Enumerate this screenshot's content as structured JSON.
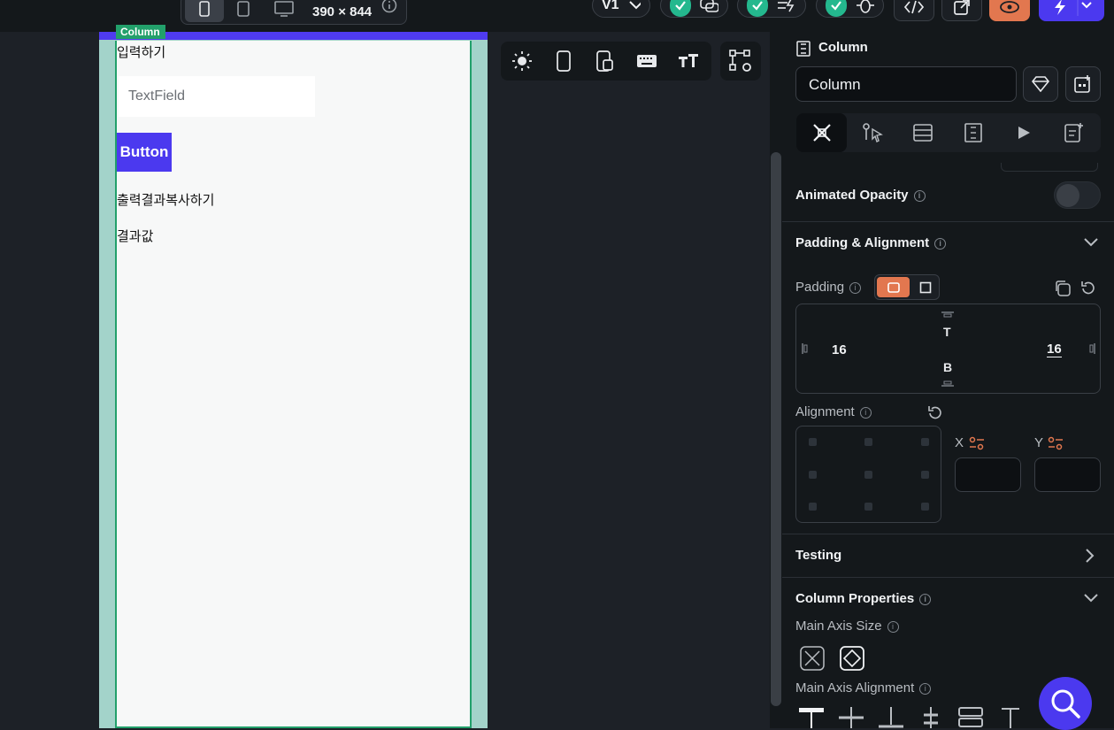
{
  "topbar": {
    "dimensions": "390 × 844",
    "version_label": "V1",
    "colors": {
      "accent": "#4b39ef",
      "success": "#24b88e",
      "preview_active": "#e2774f"
    }
  },
  "canvas": {
    "column_tag": "Column",
    "input_label": "입력하기",
    "textfield_placeholder": "TextField",
    "button_label": "Button",
    "copy_label": "출력결과복사하기",
    "result_label": "결과값"
  },
  "panel": {
    "header_title": "Column",
    "name_value": "Column",
    "animated_opacity_label": "Animated Opacity",
    "padding_alignment_title": "Padding & Alignment",
    "padding_label": "Padding",
    "padding_left": "16",
    "padding_right": "16",
    "padding_top_label": "T",
    "padding_bottom_label": "B",
    "alignment_label": "Alignment",
    "x_label": "X",
    "y_label": "Y",
    "testing_title": "Testing",
    "column_properties_title": "Column Properties",
    "main_axis_size_label": "Main Axis Size",
    "main_axis_alignment_label": "Main Axis Alignment"
  }
}
